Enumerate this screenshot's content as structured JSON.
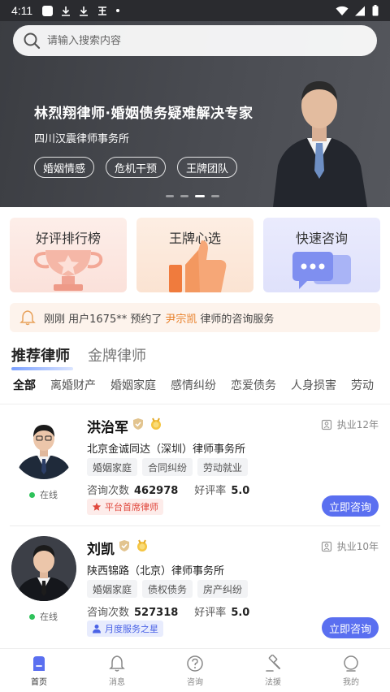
{
  "status_bar": {
    "time": "4:11"
  },
  "search": {
    "placeholder": "请输入搜索内容"
  },
  "hero": {
    "title": "林烈翔律师·婚姻债务疑难解决专家",
    "subtitle": "四川汉震律师事务所",
    "tags": [
      "婚姻情感",
      "危机干预",
      "王牌团队"
    ],
    "active_slide": 3,
    "slide_count": 4
  },
  "features": [
    {
      "label": "好评排行榜",
      "icon": "trophy-icon"
    },
    {
      "label": "王牌心选",
      "icon": "thumbs-up-icon"
    },
    {
      "label": "快速咨询",
      "icon": "chat-bubbles-icon"
    }
  ],
  "notice": {
    "prefix": "刚刚 用户1675** 预约了",
    "highlight": "尹宗凯",
    "suffix": "律师的咨询服务"
  },
  "section_tabs": [
    "推荐律师",
    "金牌律师"
  ],
  "categories": [
    "全部",
    "离婚财产",
    "婚姻家庭",
    "感情纠纷",
    "恋爱债务",
    "人身损害",
    "劳动"
  ],
  "lawyers": [
    {
      "name": "洪治军",
      "experience": "执业12年",
      "firm": "北京金诚同达（深圳）律师事务所",
      "tags": [
        "婚姻家庭",
        "合同纠纷",
        "劳动就业"
      ],
      "consult_label": "咨询次数",
      "consult_count": "462978",
      "rating_label": "好评率",
      "rating": "5.0",
      "award": "平台首席律师",
      "status": "在线",
      "button": "立即咨询"
    },
    {
      "name": "刘凯",
      "experience": "执业10年",
      "firm": "陕西锦路（北京）律师事务所",
      "tags": [
        "婚姻家庭",
        "债权债务",
        "房产纠纷"
      ],
      "consult_label": "咨询次数",
      "consult_count": "527318",
      "rating_label": "好评率",
      "rating": "5.0",
      "award": "月度服务之星",
      "status": "在线",
      "button": "立即咨询"
    }
  ],
  "bottom_nav": [
    {
      "label": "首页",
      "icon": "home-icon",
      "active": true
    },
    {
      "label": "消息",
      "icon": "bell-icon",
      "active": false
    },
    {
      "label": "咨询",
      "icon": "question-icon",
      "active": false
    },
    {
      "label": "法援",
      "icon": "gavel-icon",
      "active": false
    },
    {
      "label": "我的",
      "icon": "user-icon",
      "active": false
    }
  ],
  "colors": {
    "accent": "#5a6ff0",
    "highlight": "#e8802a",
    "online": "#2fc25b",
    "award_red": "#e0483d",
    "award_blue": "#4b63e6"
  }
}
